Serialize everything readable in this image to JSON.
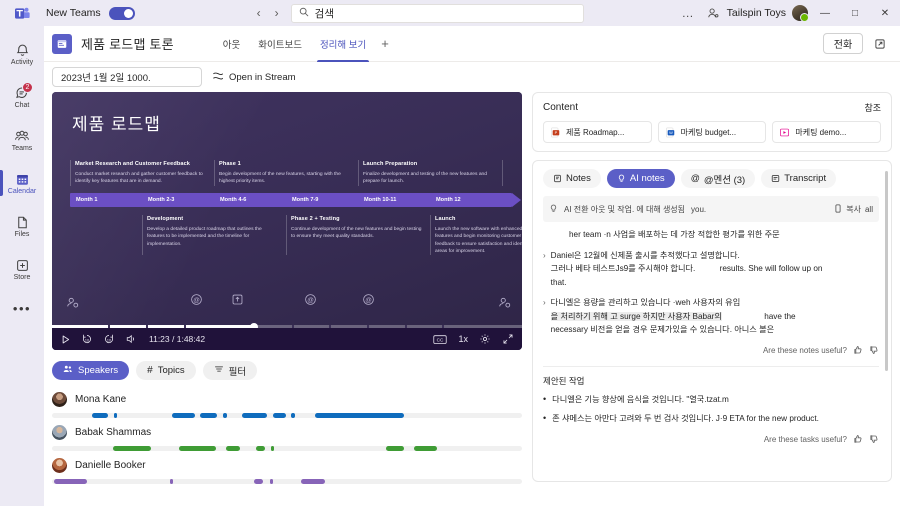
{
  "titlebar": {
    "app_logo": "teams-logo",
    "new_teams_label": "New Teams",
    "toggle_state": "on",
    "back_icon": "chevron-left-icon",
    "forward_icon": "chevron-right-icon",
    "search": {
      "icon": "search-icon",
      "value": "검색",
      "placeholder": "검색"
    },
    "overflow": "…",
    "people_icon": "people-icon",
    "org_name": "Tailspin Toys",
    "minimize": "—",
    "maximize": "□",
    "close": "✕"
  },
  "rail": {
    "items": [
      {
        "label": "Activity",
        "icon": "bell-icon",
        "active": false,
        "badge": ""
      },
      {
        "label": "Chat",
        "icon": "chat-icon",
        "active": false,
        "badge": "2"
      },
      {
        "label": "Teams",
        "icon": "teams-icon",
        "active": false,
        "badge": ""
      },
      {
        "label": "Calendar",
        "icon": "calendar-icon",
        "active": true,
        "badge": ""
      },
      {
        "label": "Files",
        "icon": "file-icon",
        "active": false,
        "badge": ""
      },
      {
        "label": "Store",
        "icon": "store-plus-icon",
        "active": false,
        "badge": ""
      }
    ],
    "more": "•••"
  },
  "meeting": {
    "icon": "meeting-notes-icon",
    "title": "제품 로드맵 토론",
    "tabs": [
      {
        "label": "아웃",
        "active": false
      },
      {
        "label": "화이트보드",
        "active": false
      },
      {
        "label": "정리해 보기",
        "active": true
      }
    ],
    "add_tab": "+",
    "join_label": "전화",
    "popout_icon": "open-in-new-icon",
    "date_value": "2023년 1월 2일 1000.",
    "stream_icon": "stream-icon",
    "stream_label": "Open in Stream"
  },
  "video": {
    "slide_title": "제품 로드맵",
    "columns": [
      {
        "title": "Market Research and Customer Feedback",
        "desc": "Conduct market research and gather customer feedback to identify key features that are in demand."
      },
      {
        "title": "Phase 1",
        "desc": "Begin development of the new features, starting with the highest priority items."
      },
      {
        "title": "Launch Preparation",
        "desc": "Finalize development and testing of the new features and prepare for launch."
      }
    ],
    "timeline": [
      "Month 1",
      "Month 2-3",
      "Month 4-6",
      "Month 7-9",
      "Month 10-11",
      "Month 12"
    ],
    "bottom_columns": [
      {
        "title": "Development",
        "desc": "Develop a detailed product roadmap that outlines the features to be implemented and the timeline for implementation."
      },
      {
        "title": "Phase 2 + Testing",
        "desc": "Continue development of the new features and begin testing to ensure they meet quality standards."
      },
      {
        "title": "Launch",
        "desc": "Launch the new software with enhanced features and begin monitoring customer feedback to ensure satisfaction and identify areas for improvement."
      }
    ],
    "controls": {
      "play": "play-icon",
      "rewind10": "rewind-10-icon",
      "forward10": "forward-10-icon",
      "volume": "volume-icon",
      "current_time": "11:23",
      "duration": "1:48:42",
      "time_display": "11:23 / 1:48:42",
      "cc": "CC",
      "speed": "1x",
      "settings": "settings-gear-icon",
      "fullscreen": "fullscreen-icon",
      "progress_percent": 43
    }
  },
  "filters": [
    {
      "label": "Speakers",
      "icon": "speakers-icon",
      "active": true
    },
    {
      "label": "Topics",
      "icon": "hash-icon",
      "active": false
    },
    {
      "label": "필터",
      "icon": "filter-icon",
      "active": false
    }
  ],
  "speakers": [
    {
      "name": "Mona Kane",
      "color": "#0f6cbd",
      "avatar_colors": [
        "#6d4b3a",
        "#2f2119"
      ],
      "segments": [
        [
          8.5,
          3.5
        ],
        [
          13.2,
          0.6
        ],
        [
          25.5,
          5.0
        ],
        [
          31.5,
          3.6
        ],
        [
          36.3,
          0.9
        ],
        [
          40.5,
          5.3
        ],
        [
          47.0,
          2.7
        ],
        [
          50.8,
          0.8
        ],
        [
          56.0,
          18.8
        ]
      ]
    },
    {
      "name": "Babak Shammas",
      "color": "#3f9c35",
      "avatar_colors": [
        "#9aa7b6",
        "#45525f"
      ],
      "segments": [
        [
          13.0,
          8.0
        ],
        [
          27.0,
          7.8
        ],
        [
          37.0,
          3.0
        ],
        [
          43.5,
          1.8
        ],
        [
          46.5,
          0.7
        ],
        [
          71.0,
          4.0
        ],
        [
          77.0,
          5.0
        ]
      ]
    },
    {
      "name": "Danielle Booker",
      "color": "#8764b8",
      "avatar_colors": [
        "#b5663f",
        "#6d2f1c"
      ],
      "segments": [
        [
          0.5,
          7.0
        ],
        [
          25.0,
          0.7
        ],
        [
          43.0,
          2.0
        ],
        [
          46.3,
          0.8
        ],
        [
          53.0,
          5.0
        ]
      ]
    }
  ],
  "content_card": {
    "title": "Content",
    "link": "참조",
    "files": [
      {
        "name": "제품 Roadmap...",
        "icon": "powerpoint-icon",
        "color": "#c43e1c"
      },
      {
        "name": "마케팅 budget...",
        "icon": "word-icon",
        "color": "#185abd"
      },
      {
        "name": "마케팅 demo...",
        "icon": "video-icon",
        "color": "#e3008c"
      }
    ]
  },
  "notes_panel": {
    "tabs": [
      {
        "label": "Notes",
        "icon": "notes-icon",
        "active": false
      },
      {
        "label": "AI notes",
        "icon": "lightbulb-icon",
        "active": true
      },
      {
        "label": "@멘션 (3)",
        "icon": "mention-icon",
        "active": false
      },
      {
        "label": "Transcript",
        "icon": "transcript-icon",
        "active": false
      }
    ],
    "ai_banner": {
      "icon": "lightbulb-icon",
      "text": "AI 전환 아웃 및 작업. 에 대해 생성됨",
      "trailing": "you.",
      "copy_icon": "copy-icon",
      "copy_label": "복사",
      "all_label": "all"
    },
    "intro_line": "her team ·n 사업을 배포하는 데 가장 적합한 평가를 위한 주문",
    "notes": [
      {
        "chevron": "›",
        "lines": [
          "Daniel은 12월에 신제품 출시를 추적했다고 설명합니다.",
          "그러나 베타 테스트Js9를 주시해야 합니다.",
          "results. She will follow up on",
          "that."
        ]
      },
      {
        "chevron": "›",
        "lines": [
          "다니엘은 용량을 관리하고 있습니다 ·weh 사용자의 유입",
          "을 처리하기 위해 고  surge 하지만 사용자 Babar의",
          "have the",
          "necessary 비전을 얻을 경우 문제가있을 수 있습니다. 아니스 볼은"
        ]
      }
    ],
    "notes_feedback": {
      "question": "Are these notes useful?",
      "thumb_up": "thumbs-up-icon",
      "thumb_down": "thumbs-down-icon"
    },
    "tasks_title": "제안된 작업",
    "tasks": [
      {
        "bullet": "•",
        "text": "다니엘은 기능 향상에 음식을 것입니다. \"열국.tzat.m"
      },
      {
        "bullet": "•",
        "text": "존 샤메스는 아만다 고려와 두 번 검사 것입니다. J·9 ETA     for the new product."
      }
    ],
    "tasks_feedback": {
      "question": "Are these tasks useful?",
      "thumb_up": "thumbs-up-icon",
      "thumb_down": "thumbs-down-icon"
    }
  },
  "colors": {
    "accent": "#5b5fc7",
    "rail_bg": "#eceaf4",
    "video_bg": "#3b3057",
    "timeline": "#6b4fc4",
    "badge_red": "#c4314b",
    "presence_green": "#6bb700"
  }
}
